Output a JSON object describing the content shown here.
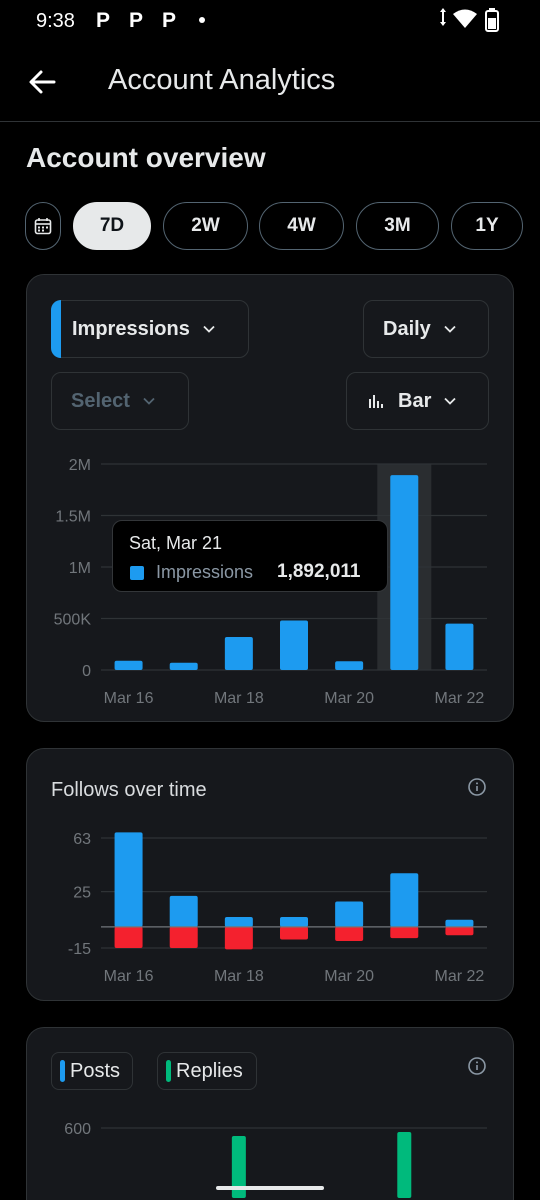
{
  "status_bar": {
    "time": "9:38",
    "notification_icons": [
      "P",
      "P",
      "P"
    ],
    "system_icons": [
      "data-arrows-icon",
      "wifi-icon",
      "battery-icon"
    ]
  },
  "app_bar": {
    "title": "Account Analytics",
    "back_icon": "back-arrow-icon"
  },
  "overview": {
    "title": "Account overview",
    "calendar_icon": "calendar-icon",
    "ranges": [
      {
        "label": "7D",
        "selected": true
      },
      {
        "label": "2W",
        "selected": false
      },
      {
        "label": "4W",
        "selected": false
      },
      {
        "label": "3M",
        "selected": false
      },
      {
        "label": "1Y",
        "selected": false
      }
    ]
  },
  "impressions_card": {
    "metric_dropdown": "Impressions",
    "interval_dropdown": "Daily",
    "compare_dropdown": "Select",
    "chart_type_dropdown": "Bar",
    "tooltip": {
      "date": "Sat, Mar 21",
      "metric": "Impressions",
      "value": "1,892,011"
    }
  },
  "follows_card": {
    "title": "Follows over time"
  },
  "posts_card": {
    "legend": [
      {
        "label": "Posts",
        "color": "#1d9bf0"
      },
      {
        "label": "Replies",
        "color": "#00ba7c"
      }
    ]
  },
  "colors": {
    "accent_blue": "#1d9bf0",
    "negative_red": "#f4212e",
    "green": "#00ba7c"
  },
  "chart_data": [
    {
      "type": "bar",
      "categories": [
        "Mar 16",
        "Mar 17",
        "Mar 18",
        "Mar 19",
        "Mar 20",
        "Mar 21",
        "Mar 22"
      ],
      "x_tick_labels": [
        "Mar 16",
        "Mar 18",
        "Mar 20",
        "Mar 22"
      ],
      "y_tick_labels": [
        "2M",
        "1.5M",
        "1M",
        "500K",
        "0"
      ],
      "ylim": [
        0,
        2000000
      ],
      "series": [
        {
          "values": [
            90000,
            70000,
            320000,
            480000,
            85000,
            1892011,
            450000
          ],
          "color": "#1d9bf0"
        }
      ],
      "highlighted_index": 5,
      "grid": true
    },
    {
      "type": "bar",
      "title": "Follows over time",
      "categories": [
        "Mar 16",
        "Mar 17",
        "Mar 18",
        "Mar 19",
        "Mar 20",
        "Mar 21",
        "Mar 22"
      ],
      "x_tick_labels": [
        "Mar 16",
        "Mar 18",
        "Mar 20",
        "Mar 22"
      ],
      "y_tick_labels": [
        "63",
        "25",
        "-15"
      ],
      "ylim": [
        -15,
        63
      ],
      "series": [
        {
          "values": [
            67,
            22,
            7,
            7,
            18,
            38,
            5
          ],
          "color": "#1d9bf0"
        },
        {
          "values": [
            -15,
            -15,
            -16,
            -9,
            -10,
            -8,
            -6
          ],
          "color": "#f4212e"
        }
      ],
      "grid": true
    },
    {
      "type": "bar",
      "y_tick_labels": [
        "600"
      ],
      "series": [
        {
          "name": "Posts",
          "values": [],
          "color": "#1d9bf0"
        },
        {
          "name": "Replies",
          "values": [],
          "color": "#00ba7c"
        }
      ],
      "grid": true
    }
  ]
}
